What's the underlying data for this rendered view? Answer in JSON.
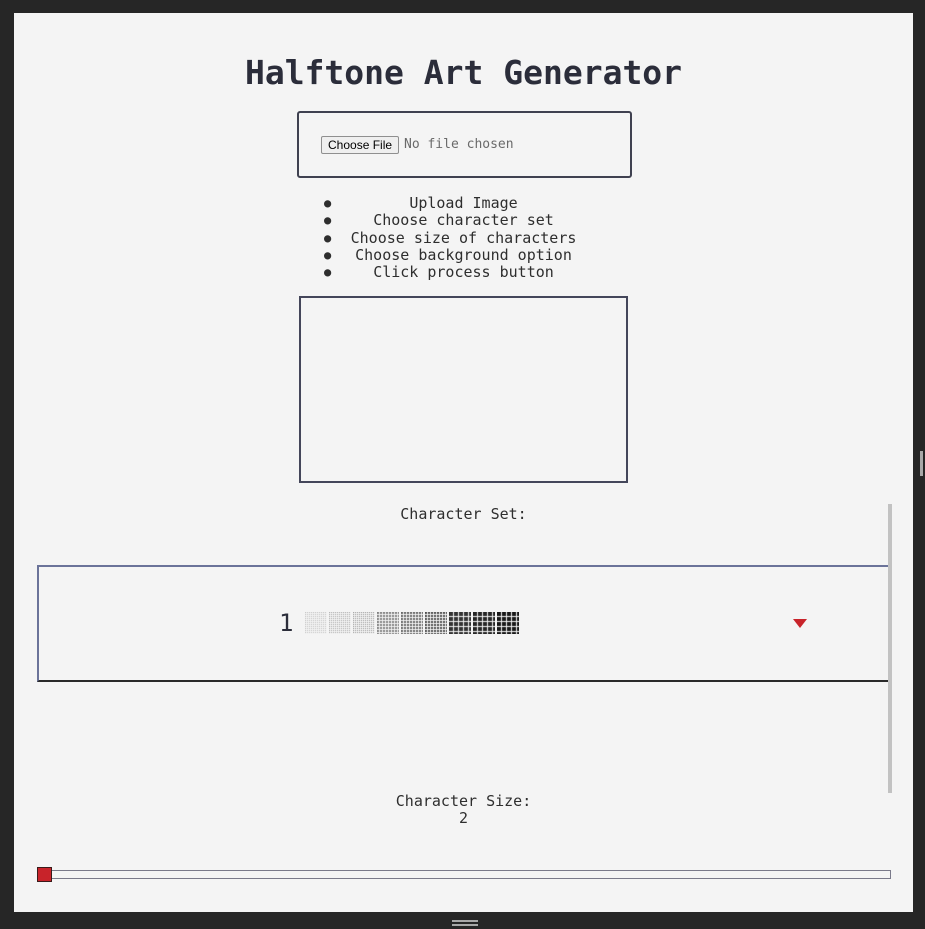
{
  "header": {
    "title": "Halftone Art Generator"
  },
  "upload": {
    "button_label": "Choose File",
    "status": "No file chosen"
  },
  "instructions": [
    "Upload Image",
    "Choose character set",
    "Choose size of characters",
    "Choose background option",
    "Click process button"
  ],
  "character_set": {
    "label": "Character Set:",
    "selected_value": "1",
    "swatches": [
      {
        "density": 0.25
      },
      {
        "density": 0.35
      },
      {
        "density": 0.42
      },
      {
        "density": 0.5
      },
      {
        "density": 0.6
      },
      {
        "density": 0.7
      },
      {
        "density": 0.8
      },
      {
        "density": 0.85
      },
      {
        "density": 0.9
      }
    ],
    "arrow_color": "#c8232a"
  },
  "character_size": {
    "label": "Character Size:",
    "value": "2",
    "slider_fraction": 0.0,
    "thumb_color": "#c8232a"
  }
}
